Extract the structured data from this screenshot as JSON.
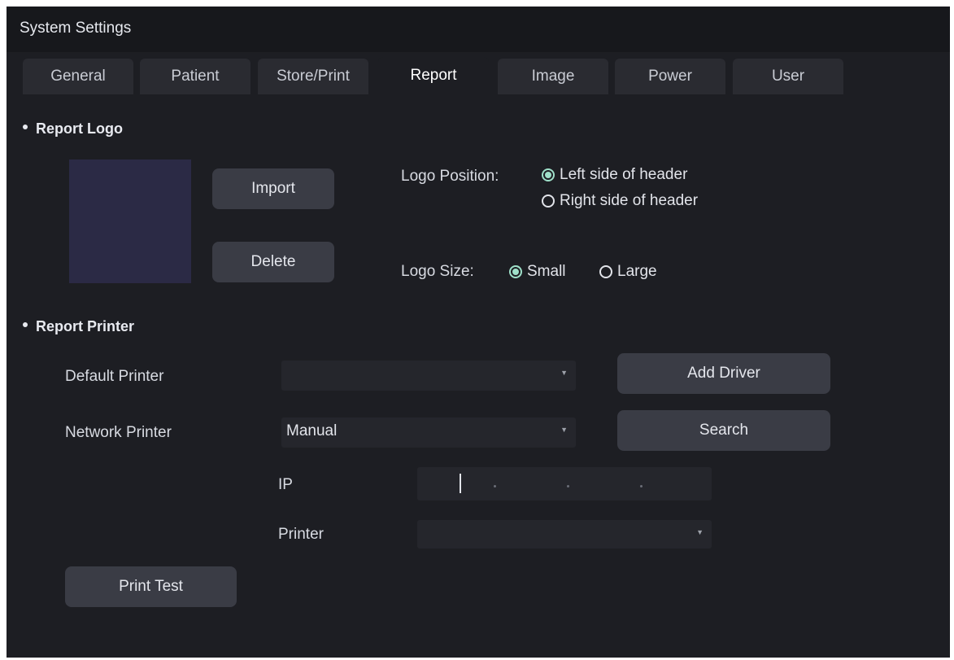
{
  "window": {
    "title": "System Settings"
  },
  "tabs": [
    {
      "label": "General"
    },
    {
      "label": "Patient"
    },
    {
      "label": "Store/Print"
    },
    {
      "label": "Report",
      "active": true
    },
    {
      "label": "Image"
    },
    {
      "label": "Power"
    },
    {
      "label": "User"
    }
  ],
  "report_logo": {
    "heading": "Report Logo",
    "import_label": "Import",
    "delete_label": "Delete",
    "position_label": "Logo Position:",
    "position_left": "Left side of header",
    "position_right": "Right side of header",
    "position_selected": "left",
    "size_label": "Logo Size:",
    "size_small": "Small",
    "size_large": "Large",
    "size_selected": "small"
  },
  "report_printer": {
    "heading": "Report Printer",
    "default_label": "Default Printer",
    "default_value": "",
    "add_driver_label": "Add Driver",
    "network_label": "Network Printer",
    "network_value": "Manual",
    "search_label": "Search",
    "ip_label": "IP",
    "printer_label": "Printer",
    "printer_value": "",
    "print_test_label": "Print Test"
  },
  "colors": {
    "background": "#1d1e23",
    "accent": "#9fe0c9",
    "button": "#3a3c45"
  }
}
